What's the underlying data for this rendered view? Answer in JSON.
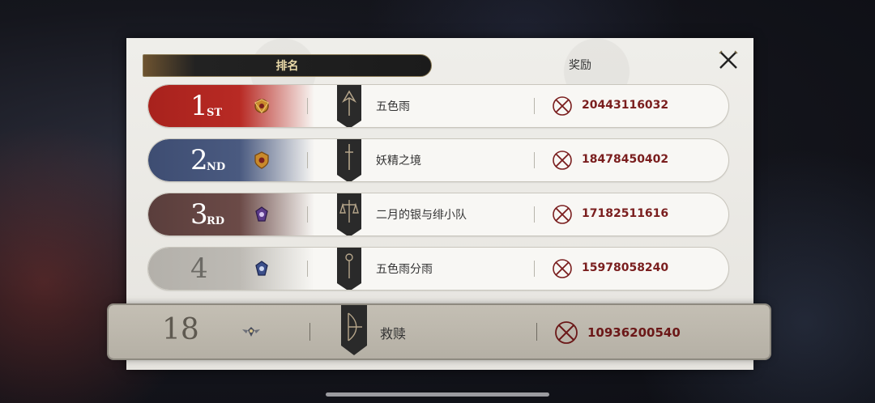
{
  "tabs": {
    "rank_label": "排名",
    "reward_label": "奖励"
  },
  "colors": {
    "first": "#b82a24",
    "second": "#4a5a80",
    "third": "#6b4a47",
    "fourth": "#bdbab4",
    "reward_value": "#7a1e1e"
  },
  "rows": [
    {
      "rank": "1",
      "suffix": "ST",
      "emblem": "gold-crest-icon",
      "banner": "dragon-banner-icon",
      "name": "五色雨",
      "reward": "20443116032"
    },
    {
      "rank": "2",
      "suffix": "ND",
      "emblem": "gold-shield-icon",
      "banner": "sword-banner-icon",
      "name": "妖精之境",
      "reward": "18478450402"
    },
    {
      "rank": "3",
      "suffix": "RD",
      "emblem": "purple-crest-icon",
      "banner": "scales-banner-icon",
      "name": "二月的银与绯小队",
      "reward": "17182511616"
    },
    {
      "rank": "4",
      "suffix": "",
      "emblem": "blue-crest-icon",
      "banner": "staff-banner-icon",
      "name": "五色雨分雨",
      "reward": "15978058240"
    }
  ],
  "self": {
    "rank": "18",
    "emblem": "winged-crest-icon",
    "banner": "bow-banner-icon",
    "name": "救赎",
    "reward": "10936200540"
  }
}
